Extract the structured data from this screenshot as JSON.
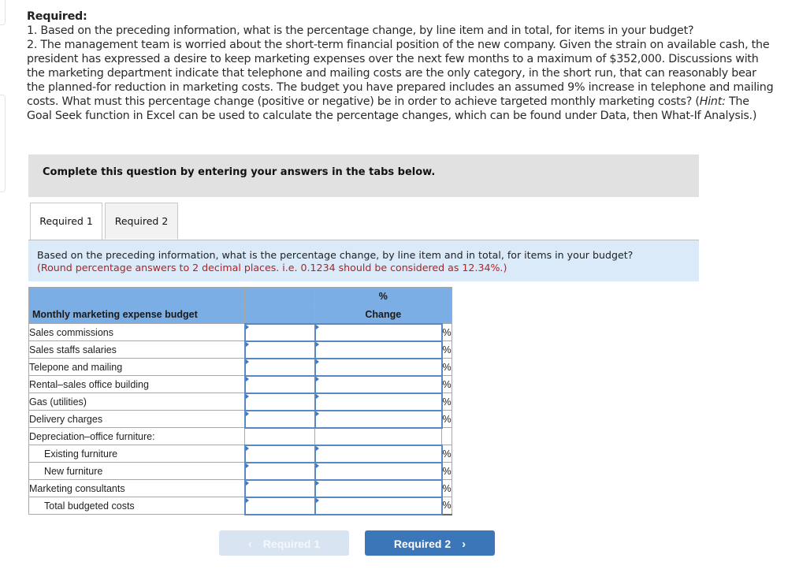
{
  "required": {
    "heading": "Required:",
    "item1": "1. Based on the preceding information, what is the percentage change, by line item and in total, for items in your budget?",
    "item2_main": "2. The management team is worried about the short-term financial position of the new company. Given the strain on available cash, the president has expressed a desire to keep marketing expenses over the next few months to a maximum of $352,000. Discussions with the marketing department indicate that telephone and mailing costs are the only category, in the short run, that can reasonably bear the planned-for reduction in marketing costs. The budget you have prepared includes an assumed 9% increase in telephone and mailing costs. What must this percentage change (positive or negative) be in order to achieve targeted monthly marketing costs? (",
    "item2_hint_label": "Hint:",
    "item2_tail": " The Goal Seek function in Excel can be used to calculate the percentage changes, which can be found under Data, then What-If Analysis.)"
  },
  "instruction": "Complete this question by entering your answers in the tabs below.",
  "tabs": [
    {
      "label": "Required 1",
      "active": true
    },
    {
      "label": "Required 2",
      "active": false
    }
  ],
  "question": {
    "text": "Based on the preceding information, what is the percentage change, by line item and in total, for items in your budget?",
    "hint": "(Round percentage answers to 2 decimal places. i.e. 0.1234 should be considered as 12.34%.)"
  },
  "table": {
    "header_top_pct": "%",
    "header_label": "Monthly marketing expense budget",
    "header_change": "Change",
    "unit_symbol": "%",
    "rows": [
      {
        "label": "Sales commissions",
        "amount": "",
        "pct": ""
      },
      {
        "label": "Sales staffs salaries",
        "amount": "",
        "pct": ""
      },
      {
        "label": "Telepone and mailing",
        "amount": "",
        "pct": ""
      },
      {
        "label": "Rental–sales office building",
        "amount": "",
        "pct": ""
      },
      {
        "label": "Gas (utilities)",
        "amount": "",
        "pct": ""
      },
      {
        "label": "Delivery charges",
        "amount": "",
        "pct": ""
      },
      {
        "label": "Depreciation–office furniture:"
      },
      {
        "label": "Existing furniture",
        "amount": "",
        "pct": ""
      },
      {
        "label": "New furniture",
        "amount": "",
        "pct": ""
      },
      {
        "label": "Marketing consultants",
        "amount": "",
        "pct": ""
      },
      {
        "label": "Total budgeted costs",
        "amount": "",
        "pct": ""
      }
    ]
  },
  "nav": {
    "prev_label": "Required 1",
    "next_label": "Required 2",
    "prev_icon": "chevron-left",
    "next_icon": "chevron-right"
  },
  "colors": {
    "header_blue": "#7aaee4",
    "question_bg": "#daeaf8",
    "hint_red": "#b22222",
    "next_button": "#3a76b8",
    "prev_button_disabled": "#d8e4f1"
  }
}
